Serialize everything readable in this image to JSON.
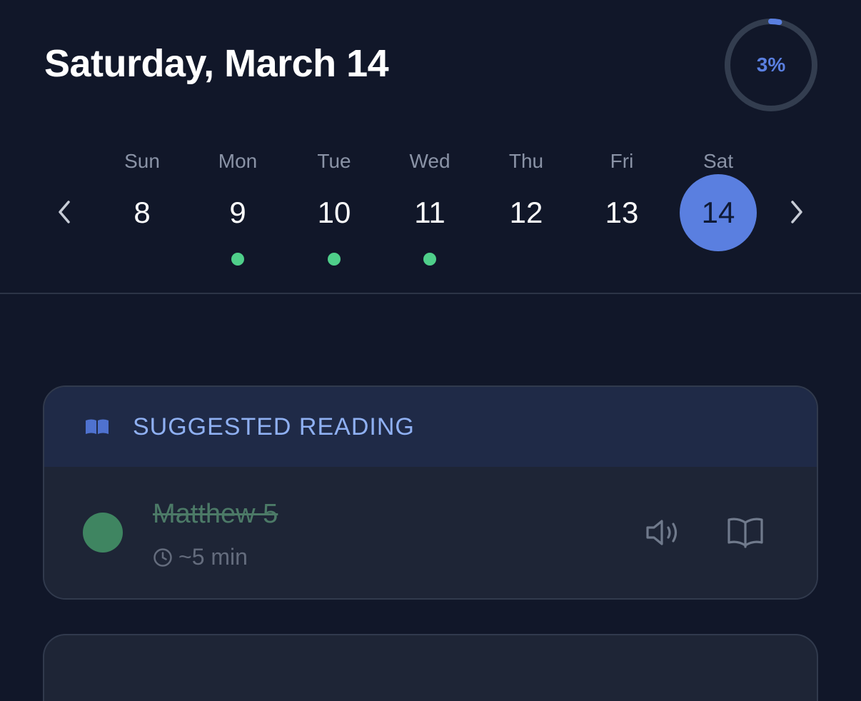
{
  "header": {
    "date_title": "Saturday, March 14",
    "progress_label": "3%",
    "progress_fraction": 0.03
  },
  "week": {
    "days": [
      {
        "dow": "Sun",
        "num": "8",
        "completed": false,
        "selected": false
      },
      {
        "dow": "Mon",
        "num": "9",
        "completed": true,
        "selected": false
      },
      {
        "dow": "Tue",
        "num": "10",
        "completed": true,
        "selected": false
      },
      {
        "dow": "Wed",
        "num": "11",
        "completed": true,
        "selected": false
      },
      {
        "dow": "Thu",
        "num": "12",
        "completed": false,
        "selected": false
      },
      {
        "dow": "Fri",
        "num": "13",
        "completed": false,
        "selected": false
      },
      {
        "dow": "Sat",
        "num": "14",
        "completed": false,
        "selected": true
      }
    ]
  },
  "suggested": {
    "header_label": "SUGGESTED READING",
    "item": {
      "title": "Matthew 5",
      "duration": "~5 min",
      "completed": true
    }
  },
  "colors": {
    "accent": "#5a7fe0",
    "completed_dot": "#4fcf8a",
    "background": "#111729",
    "card": "#1e2536"
  },
  "icons": {
    "prev": "chevron-left-icon",
    "next": "chevron-right-icon",
    "header": "open-book-icon",
    "clock": "clock-icon",
    "audio": "speaker-icon",
    "read": "book-outline-icon"
  }
}
